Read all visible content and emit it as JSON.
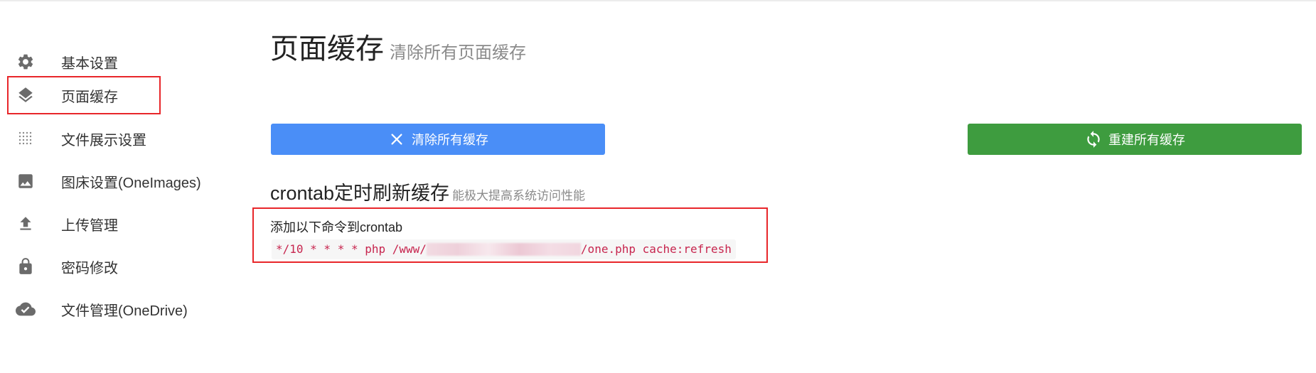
{
  "sidebar": {
    "items": [
      {
        "label": "基本设置",
        "icon": "gear-icon"
      },
      {
        "label": "页面缓存",
        "icon": "layers-icon",
        "active": true
      },
      {
        "label": "文件展示设置",
        "icon": "dot-grid-icon"
      },
      {
        "label": "图床设置(OneImages)",
        "icon": "image-icon"
      },
      {
        "label": "上传管理",
        "icon": "upload-icon"
      },
      {
        "label": "密码修改",
        "icon": "lock-icon"
      },
      {
        "label": "文件管理(OneDrive)",
        "icon": "cloud-done-icon"
      }
    ]
  },
  "header": {
    "title": "页面缓存",
    "subtitle": "清除所有页面缓存"
  },
  "actions": {
    "clear_label": "清除所有缓存",
    "clear_icon": "close-icon",
    "clear_color": "#4a8ef7",
    "rebuild_label": "重建所有缓存",
    "rebuild_icon": "refresh-icon",
    "rebuild_color": "#3e9c3f"
  },
  "crontab": {
    "title": "crontab定时刷新缓存",
    "subtitle": "能极大提高系统访问性能",
    "intro": "添加以下命令到crontab",
    "command_prefix": "*/10 * * * * php /www/",
    "command_suffix": "/one.php cache:refresh"
  },
  "colors": {
    "highlight_border": "#e8262a",
    "code_text": "#c7254e"
  }
}
